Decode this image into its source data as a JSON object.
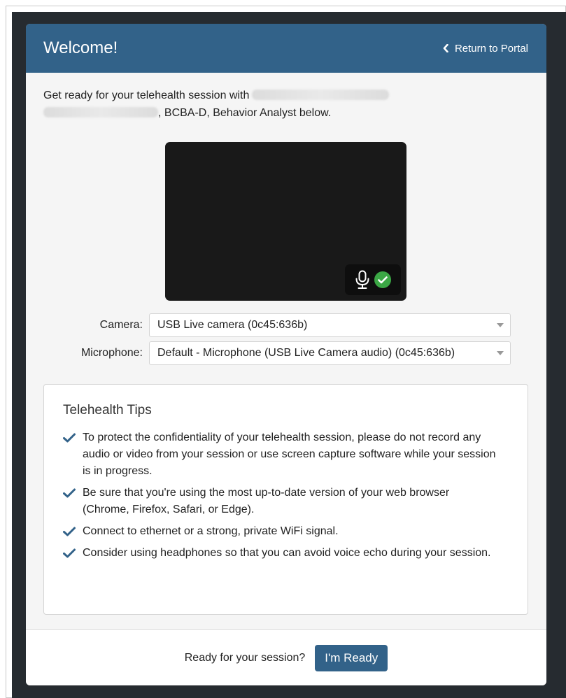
{
  "header": {
    "title": "Welcome!",
    "return_label": "Return to Portal"
  },
  "intro": {
    "prefix": "Get ready for your telehealth session with",
    "suffix": ", BCBA-D, Behavior Analyst below."
  },
  "video": {
    "mic_icon": "microphone-icon",
    "status_icon": "check-circle-icon"
  },
  "devices": {
    "camera_label": "Camera:",
    "camera_value": "USB Live camera (0c45:636b)",
    "microphone_label": "Microphone:",
    "microphone_value": "Default - Microphone (USB Live Camera audio) (0c45:636b)"
  },
  "tips": {
    "title": "Telehealth Tips",
    "items": [
      "To protect the confidentiality of your telehealth session, please do not record any audio or video from your session or use screen capture software while your session is in progress.",
      "Be sure that you're using the most up-to-date version of your web browser (Chrome, Firefox, Safari, or Edge).",
      "Connect to ethernet or a strong, private WiFi signal.",
      "Consider using headphones so that you can avoid voice echo during your session."
    ]
  },
  "footer": {
    "question": "Ready for your session?",
    "ready_label": "I'm Ready"
  },
  "colors": {
    "header_bg": "#326289",
    "button_bg": "#326289",
    "success": "#3ba745",
    "backdrop": "#262b30"
  }
}
